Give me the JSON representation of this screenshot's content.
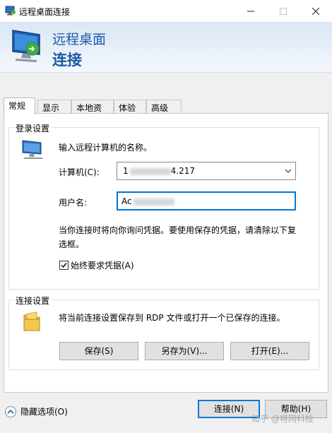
{
  "window": {
    "title": "远程桌面连接",
    "controls": {
      "minimize": "—",
      "maximize": "☐",
      "close": "✕"
    }
  },
  "header": {
    "line1": "远程桌面",
    "line2": "连接"
  },
  "tabs": [
    {
      "label": "常规",
      "active": true
    },
    {
      "label": "显示",
      "active": false
    },
    {
      "label": "本地资源",
      "active": false
    },
    {
      "label": "体验",
      "active": false
    },
    {
      "label": "高级",
      "active": false
    }
  ],
  "login_settings": {
    "group_title": "登录设置",
    "prompt": "输入远程计算机的名称。",
    "computer_label": "计算机(C):",
    "computer_value_prefix": "1",
    "computer_value_suffix": "4.217",
    "username_label": "用户名:",
    "username_value_prefix": "Ac",
    "credential_note": "当你连接时将向你询问凭据。要使用保存的凭据，请清除以下复选框。",
    "checkbox_label": "始终要求凭据(A)",
    "checkbox_checked": true
  },
  "connection_settings": {
    "group_title": "连接设置",
    "description": "将当前连接设置保存到 RDP 文件或打开一个已保存的连接。",
    "save_button": "保存(S)",
    "save_as_button": "另存为(V)...",
    "open_button": "打开(E)..."
  },
  "footer": {
    "hide_options": "隐藏选项(O)",
    "connect_button": "连接(N)",
    "help_button": "帮助(H)"
  },
  "watermark": "知乎 @将网科技",
  "icons": {
    "app": "remote-desktop-icon",
    "computer": "computer-icon",
    "folder": "folder-icon",
    "dropdown": "chevron-down-icon",
    "collapse": "chevron-up-icon"
  },
  "colors": {
    "header_text": "#1a5aa8",
    "focus_border": "#0078d7"
  }
}
